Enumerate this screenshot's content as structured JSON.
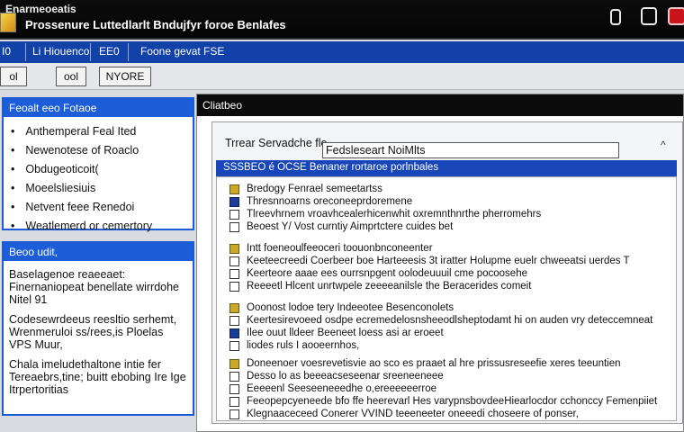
{
  "window": {
    "small_title": "Enarmeoeatis",
    "title": "Prossenure Luttedlarlt Bndujfyr foroe Benlafes"
  },
  "menu": {
    "items": [
      "I0",
      "Li Hiouenco",
      "EE0",
      "Foone gevat FSE"
    ]
  },
  "toolbar": {
    "btn1": "ol",
    "btn2": "ool",
    "btn3": "NYORE"
  },
  "left_top": {
    "title": "Feoalt eeo Fotaoe",
    "items": [
      "Anthemperal Feal Ited",
      "Newenotese of Roaclo",
      "Obdugeoticoit(",
      "Moeelsliesiuis",
      "Netvent feee Renedoi",
      "Weatlemerd or cemertory"
    ]
  },
  "left_bottom": {
    "title": "Beoo udit,",
    "notes": [
      "Baselagenoe reaeeaet: Finernaniopeat benellate wirrdohe Nitel 91",
      "Codesewrdeeus reesltio serhemt, Wrenmeruloi ss/rees,is Ploelas VPS Muur,",
      "Chala imeludethaltone intie fer Tereaebrs,tine; buitt ebobing Ire Ige Itrpertoritias"
    ]
  },
  "main": {
    "title": "Cliatbeo",
    "field_label": "Trrear Servadche fle",
    "field_value": "Fedsleseart NoiMlts",
    "list_header": "SSSBEO é OCSE Benaner rortaroe porlnbales",
    "groups": [
      {
        "header": "Bredogy Fenrael semeetartss",
        "rows": [
          "Thresnnoarns oreconeeprdoremene",
          "Tlreevhrnem vroavhcealerhicenwhit oxremnthnrthe pherromehrs",
          "Beoest Y/ Vost curntiy Aimprtctere cuides bet"
        ]
      },
      {
        "header": "Intt foeneoulfeeoceri toouonbnconeenter",
        "rows": [
          "Keeteecreedi Coerbeer boe Harteeesis 3t iratter Holupme euelr chweeatsi uerdes T",
          "Keerteore aaae ees ourrsnpgent oolodeuuuil cme pocoosehe",
          "Reeeetl Hlcent unrtwpele zeeeeanilsle the Beracerides comeit"
        ]
      },
      {
        "header": "Ooonost lodoe tery Indeeotee Besenconolets",
        "rows": [
          "Keertesirevoeed osdpe ecremedelosnsheeodlsheptodamt hi on auden vry deteccemneat",
          "Ilee ouut lldeer Beeneet loess asi ar eroeet",
          "liodes ruls I aooeernhos,"
        ]
      },
      {
        "header": "Doneenoer voesrevetisvie ao sco es praaet al hre prissusreseefie xeres teeuntien",
        "rows": [
          "Desso lo as beeeacseseenar sreeneeneee",
          "Eeeeenl Seeseeneeedhe o,ereeeeeerroe",
          "Feeopepcyeneede bfo ffe heerevarl Hes varypnsbovdeeHiearlocdor cchonccy Femenpiiet",
          "Klegnaaceceed Conerer VVIND teeeneeter oneeedi choseere of ponser,"
        ]
      }
    ]
  }
}
